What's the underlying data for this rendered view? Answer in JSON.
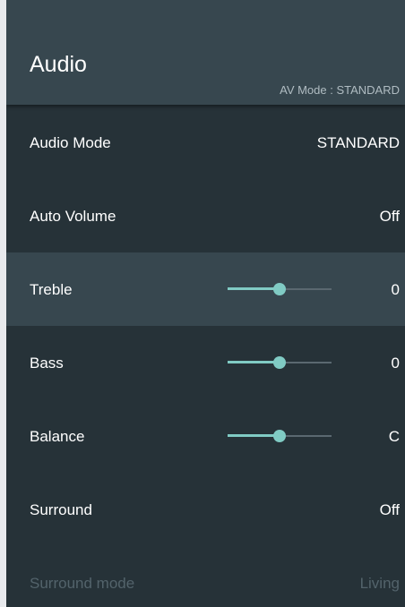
{
  "header": {
    "title": "Audio",
    "subtitle": "AV Mode : STANDARD"
  },
  "colors": {
    "accent": "#80cbc4",
    "panel": "#263238",
    "header": "#37474f",
    "disabled_text": "#53636b"
  },
  "rows": [
    {
      "label": "Audio Mode",
      "value": "STANDARD"
    },
    {
      "label": "Auto Volume",
      "value": "Off"
    },
    {
      "label": "Treble",
      "value": "0",
      "slider_level": 0.5
    },
    {
      "label": "Bass",
      "value": "0",
      "slider_level": 0.5
    },
    {
      "label": "Balance",
      "value": "C",
      "slider_level": 0.5
    },
    {
      "label": "Surround",
      "value": "Off"
    },
    {
      "label": "Surround mode",
      "value": "Living"
    }
  ]
}
